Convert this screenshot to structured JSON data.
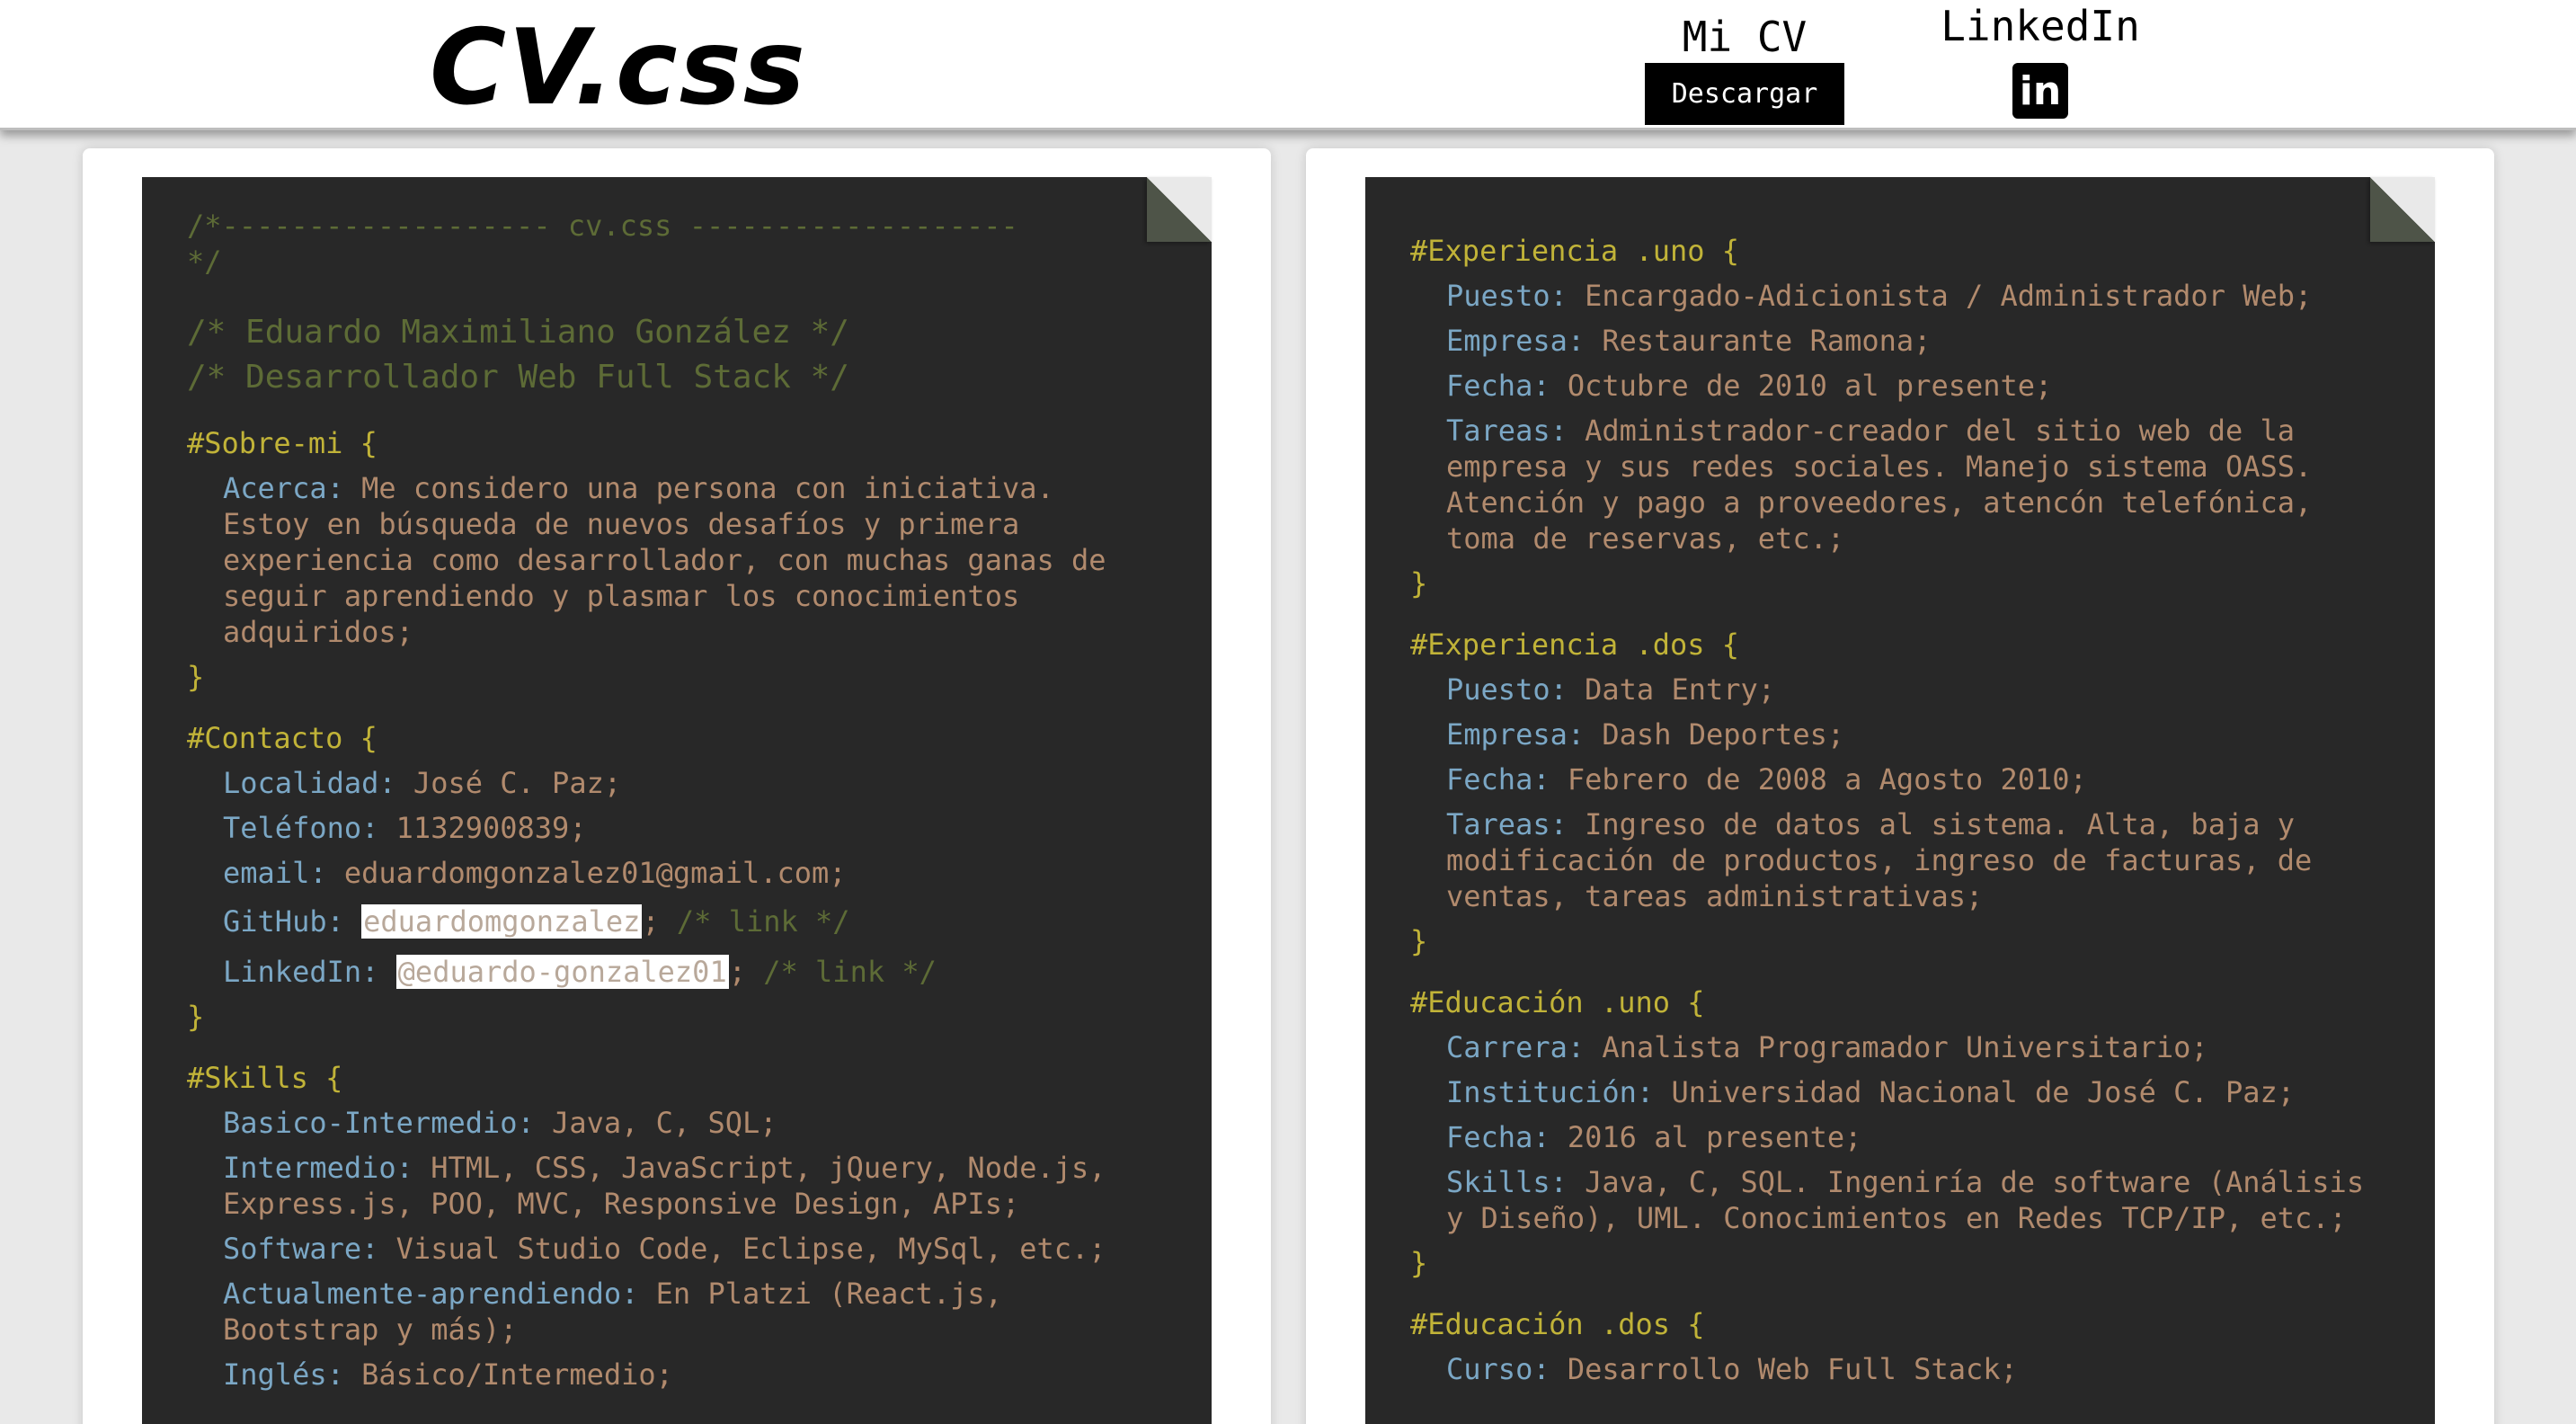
{
  "header": {
    "logo": "CV.css",
    "cv_label": "Mi CV",
    "download_label": "Descargar",
    "linkedin_label": "LinkedIn",
    "linkedin_icon": "linkedin-icon"
  },
  "left": {
    "banner_line1": "/*------------------- cv.css -------------------",
    "banner_line2": "*/",
    "name_comment": "/* Eduardo Maximiliano González */",
    "role_comment": "/* Desarrollador Web Full Stack */",
    "sobre": {
      "selector": "#Sobre-mi",
      "acerca_prop": "Acerca:",
      "acerca_val": "Me considero una persona con iniciativa. Estoy en búsqueda de nuevos desafíos y primera experiencia como desarrollador, con muchas ganas de seguir aprendiendo y plasmar los conocimientos adquiridos;"
    },
    "contacto": {
      "selector": "#Contacto",
      "localidad_prop": "Localidad:",
      "localidad_val": "José C. Paz;",
      "telefono_prop": "Teléfono:",
      "telefono_val": "1132900839;",
      "email_prop": "email:",
      "email_val": "eduardomgonzalez01@gmail.com;",
      "github_prop": "GitHub:",
      "github_val": "eduardomgonzalez",
      "github_comment": "/* link */",
      "linkedin_prop": "LinkedIn:",
      "linkedin_val": "@eduardo-gonzalez01",
      "linkedin_comment": "/* link */"
    },
    "skills": {
      "selector": "#Skills",
      "basico_prop": "Basico-Intermedio:",
      "basico_val": "Java, C, SQL;",
      "intermedio_prop": "Intermedio:",
      "intermedio_val": "HTML, CSS, JavaScript, jQuery, Node.js, Express.js, POO, MVC, Responsive Design, APIs;",
      "software_prop": "Software:",
      "software_val": "Visual Studio Code, Eclipse, MySql, etc.;",
      "aprendiendo_prop": "Actualmente-aprendiendo:",
      "aprendiendo_val": "En Platzi (React.js, Bootstrap y más);",
      "ingles_prop": "Inglés:",
      "ingles_val": "Básico/Intermedio;"
    }
  },
  "right": {
    "exp1": {
      "selector": "#Experiencia .uno",
      "puesto_prop": "Puesto:",
      "puesto_val": "Encargado-Adicionista / Administrador Web;",
      "empresa_prop": "Empresa:",
      "empresa_val": "Restaurante Ramona;",
      "fecha_prop": "Fecha:",
      "fecha_val": "Octubre de 2010 al presente;",
      "tareas_prop": "Tareas:",
      "tareas_val": "Administrador-creador del sitio web de la empresa y sus redes sociales. Manejo sistema OASS. Atención y pago a proveedores, atencón telefónica, toma de reservas, etc.;"
    },
    "exp2": {
      "selector": "#Experiencia .dos",
      "puesto_prop": "Puesto:",
      "puesto_val": "Data Entry;",
      "empresa_prop": "Empresa:",
      "empresa_val": "Dash Deportes;",
      "fecha_prop": "Fecha:",
      "fecha_val": "Febrero de 2008 a Agosto 2010;",
      "tareas_prop": "Tareas:",
      "tareas_val": "Ingreso de datos al sistema. Alta, baja y modificación de productos, ingreso de facturas, de ventas, tareas administrativas;"
    },
    "edu1": {
      "selector": "#Educación .uno",
      "carrera_prop": "Carrera:",
      "carrera_val": "Analista Programador Universitario;",
      "inst_prop": "Institución:",
      "inst_val": "Universidad Nacional de José C. Paz;",
      "fecha_prop": "Fecha:",
      "fecha_val": "2016 al presente;",
      "skills_prop": "Skills:",
      "skills_val": "Java, C, SQL. Ingeniría de software (Análisis y Diseño), UML. Conocimientos en Redes TCP/IP, etc.;"
    },
    "edu2": {
      "selector": "#Educación .dos",
      "curso_prop": "Curso:",
      "curso_val": "Desarrollo Web Full Stack;"
    }
  },
  "syntax": {
    "open_brace": "{",
    "close_brace": "}"
  },
  "colors": {
    "sheet_bg": "#282828",
    "comment": "#5d6b36",
    "selector": "#c1b338",
    "property": "#7ba7c5",
    "value": "#b18a6d"
  }
}
